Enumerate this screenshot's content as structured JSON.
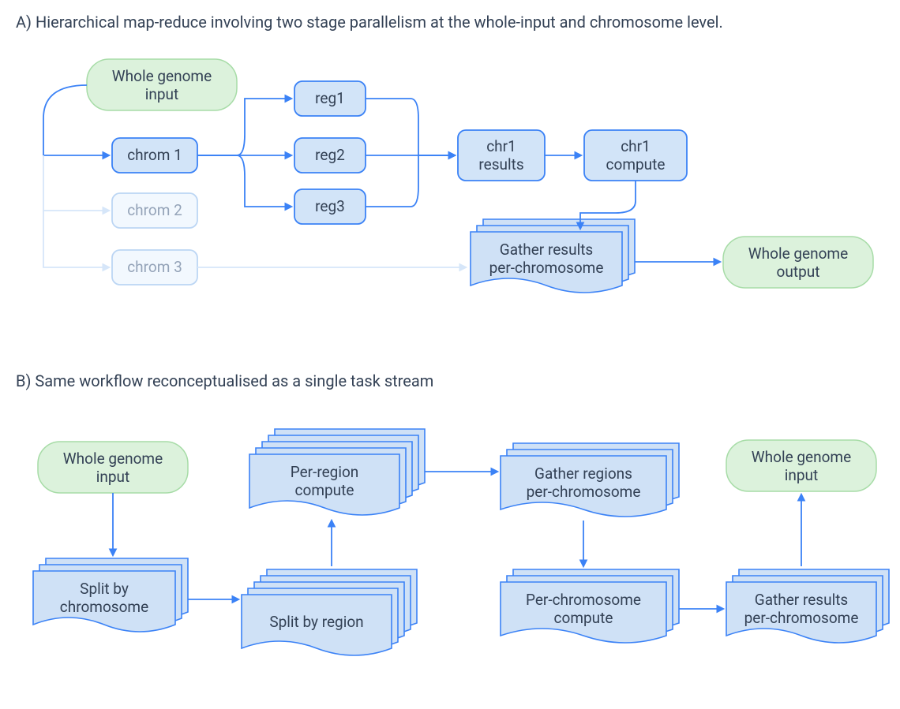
{
  "diagram": {
    "headingA": "A) Hierarchical map-reduce involving two stage parallelism at the whole-input and chromosome level.",
    "headingB": "B) Same workflow reconceptualised as a single task stream",
    "A": {
      "input": [
        "Whole genome",
        "input"
      ],
      "chrom1": "chrom 1",
      "chrom2": "chrom 2",
      "chrom3": "chrom 3",
      "reg1": "reg1",
      "reg2": "reg2",
      "reg3": "reg3",
      "chr1results": [
        "chr1",
        "results"
      ],
      "chr1compute": [
        "chr1",
        "compute"
      ],
      "gather": [
        "Gather results",
        "per-chromosome"
      ],
      "output": [
        "Whole genome",
        "output"
      ]
    },
    "B": {
      "input": [
        "Whole genome",
        "input"
      ],
      "split_chrom": [
        "Split by",
        "chromosome"
      ],
      "split_region": "Split by region",
      "per_region": [
        "Per-region",
        "compute"
      ],
      "gather_regions": [
        "Gather regions",
        "per-chromosome"
      ],
      "per_chrom": [
        "Per-chromosome",
        "compute"
      ],
      "gather_results": [
        "Gather results",
        "per-chromosome"
      ],
      "output": [
        "Whole genome",
        "input"
      ]
    },
    "colors": {
      "green_fill": "#DCF2DC",
      "green_stroke": "#A7DCA7",
      "blue_fill": "#D2E4F8",
      "blue_fill_doc": "#CFE1F6",
      "blue_stroke": "#3B82F6",
      "blue_stroke_faded": "#BCD6F4",
      "arrow": "#3B82F6",
      "arrow_faded": "#D6E6F9"
    }
  }
}
